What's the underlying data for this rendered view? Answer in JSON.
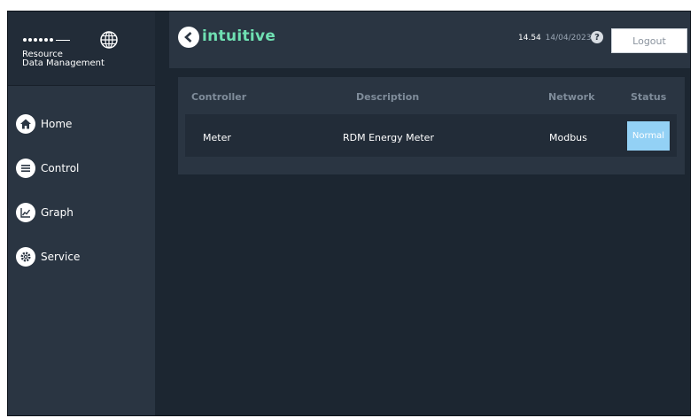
{
  "brand": {
    "name_line1": "Resource",
    "name_line2": "Data Management",
    "dots_icon": "rdm-dots-icon",
    "globe_icon": "globe-icon"
  },
  "sidebar": {
    "items": [
      {
        "label": "Home",
        "icon": "home-icon"
      },
      {
        "label": "Control",
        "icon": "list-icon"
      },
      {
        "label": "Graph",
        "icon": "graph-icon"
      },
      {
        "label": "Service",
        "icon": "gear-icon"
      }
    ]
  },
  "header": {
    "logo": "intuitive",
    "time": "14.54",
    "date": "14/04/2023",
    "help": "?",
    "logout_label": "Logout"
  },
  "table": {
    "columns": [
      "Controller",
      "Description",
      "Network",
      "Status"
    ],
    "rows": [
      {
        "controller": "Meter",
        "description": "RDM Energy Meter",
        "network": "Modbus",
        "status": "Normal"
      }
    ]
  },
  "colors": {
    "accent_green": "#6fe0b2",
    "status_normal": "#93d1f5",
    "panel": "#2a3542",
    "background": "#1c2631"
  }
}
